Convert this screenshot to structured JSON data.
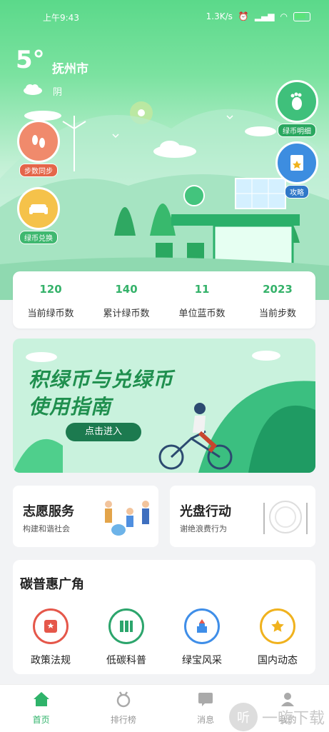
{
  "status_bar": {
    "time": "上午9:43",
    "net_speed": "1.3K/s"
  },
  "weather": {
    "temperature": "5°",
    "city": "抚州市",
    "condition": "阴"
  },
  "floating_buttons": {
    "steps_sync": "步数同步",
    "coin_detail": "绿币明细",
    "guide": "攻略",
    "coin_exchange": "绿币兑换"
  },
  "stats": [
    {
      "value": "120",
      "label": "当前绿币数"
    },
    {
      "value": "140",
      "label": "累计绿币数"
    },
    {
      "value": "11",
      "label": "单位蓝币数"
    },
    {
      "value": "2023",
      "label": "当前步数"
    }
  ],
  "banner": {
    "line1": "积绿币与兑绿币",
    "line2": "使用指南",
    "button": "点击进入"
  },
  "cards": {
    "volunteer": {
      "title": "志愿服务",
      "sub": "构建和谐社会"
    },
    "plate": {
      "title": "光盘行动",
      "sub": "谢绝浪费行为"
    }
  },
  "carbon": {
    "heading": "碳普惠广角",
    "items": [
      {
        "label": "政策法规",
        "icon": "policy-icon",
        "color": "#e5574a"
      },
      {
        "label": "低碳科普",
        "icon": "books-icon",
        "color": "#2ca56c"
      },
      {
        "label": "绿宝风采",
        "icon": "tower-icon",
        "color": "#3f8ee8"
      },
      {
        "label": "国内动态",
        "icon": "star-icon",
        "color": "#f0b21e"
      }
    ]
  },
  "tabs": [
    {
      "label": "首页"
    },
    {
      "label": "排行榜"
    },
    {
      "label": "消息"
    },
    {
      "label": "我的"
    }
  ],
  "watermark": "一嗨下载",
  "colors": {
    "accent": "#2fb36a",
    "hero_top": "#5bd98a"
  }
}
